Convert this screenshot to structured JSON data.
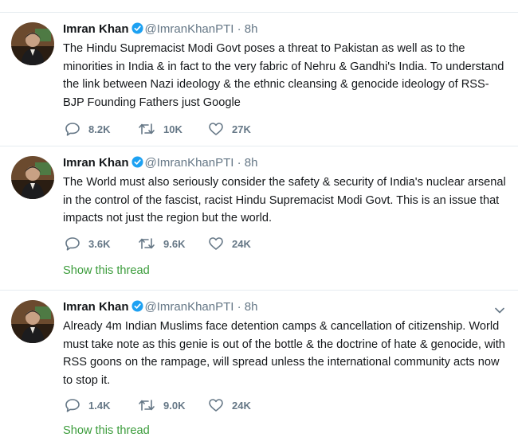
{
  "brand": {
    "verified_color": "#1da1f2",
    "link_color": "#3b9c3b",
    "muted_color": "#657786"
  },
  "tweets": [
    {
      "name": "Imran Khan",
      "handle": "@ImranKhanPTI",
      "sep": "·",
      "time": "8h",
      "text": "The Hindu Supremacist Modi Govt poses a threat to Pakistan as well as to the minorities in India & in fact to the very fabric of Nehru & Gandhi's India. To understand the link between Nazi ideology & the ethnic cleansing & genocide ideology of RSS-BJP Founding Fathers just Google",
      "replies": "8.2K",
      "retweets": "10K",
      "likes": "27K",
      "thread_label": ""
    },
    {
      "name": "Imran Khan",
      "handle": "@ImranKhanPTI",
      "sep": "·",
      "time": "8h",
      "text": "The World must also seriously consider  the safety & security of India's nuclear arsenal in the control of the fascist, racist Hindu Supremacist Modi Govt. This is an issue that impacts not just the region but the world.",
      "replies": "3.6K",
      "retweets": "9.6K",
      "likes": "24K",
      "thread_label": "Show this thread"
    },
    {
      "name": "Imran Khan",
      "handle": "@ImranKhanPTI",
      "sep": "·",
      "time": "8h",
      "text": "Already 4m Indian Muslims face detention camps & cancellation of citizenship. World must take note as this genie is out of the bottle & the doctrine of hate & genocide, with RSS goons on the rampage, will spread unless the international community acts now to stop it.",
      "replies": "1.4K",
      "retweets": "9.0K",
      "likes": "24K",
      "thread_label": "Show this thread"
    }
  ],
  "icons": {
    "avatar": "avatar-photo",
    "verified": "verified-badge-icon",
    "menu": "chevron-down-icon",
    "reply": "reply-icon",
    "retweet": "retweet-icon",
    "like": "heart-icon"
  }
}
